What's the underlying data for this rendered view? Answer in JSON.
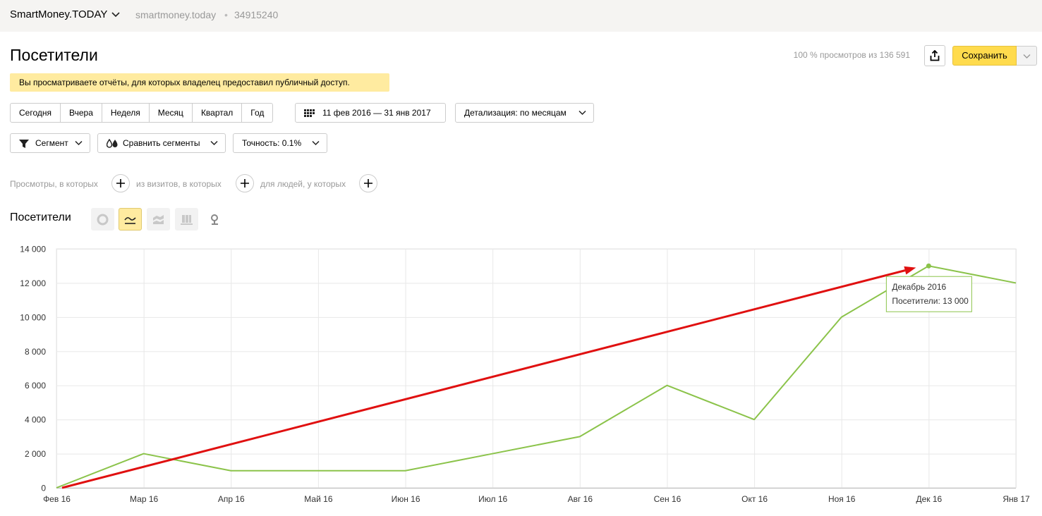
{
  "header": {
    "site_name": "SmartMoney.TODAY",
    "domain": "smartmoney.today",
    "separator": "•",
    "counter_id": "34915240"
  },
  "page": {
    "title": "Посетители",
    "sample_info": "100 % просмотров из 136 591",
    "save_label": "Сохранить",
    "notice": "Вы просматриваете отчёты, для которых владелец предоставил публичный доступ."
  },
  "periods": [
    "Сегодня",
    "Вчера",
    "Неделя",
    "Месяц",
    "Квартал",
    "Год"
  ],
  "date_range": "11 фев 2016 — 31 янв 2017",
  "detail_label": "Детализация: по месяцам",
  "segment_label": "Сегмент",
  "compare_label": "Сравнить сегменты",
  "accuracy_label": "Точность: 0.1%",
  "filters": {
    "views": "Просмотры, в которых",
    "visits": "из визитов, в которых",
    "people": "для людей, у которых"
  },
  "chart_header": {
    "title": "Посетители"
  },
  "tooltip": {
    "title": "Декабрь 2016",
    "value": "Посетители: 13 000"
  },
  "colors": {
    "series": "#8bc34a",
    "annotation_arrow": "#e01010",
    "save_button": "#ffdb4d",
    "notice_bg": "#ffeba0"
  },
  "chart_data": {
    "type": "line",
    "categories": [
      "Фев 16",
      "Мар 16",
      "Апр 16",
      "Май 16",
      "Июн 16",
      "Июл 16",
      "Авг 16",
      "Сен 16",
      "Окт 16",
      "Ноя 16",
      "Дек 16",
      "Янв 17"
    ],
    "series": [
      {
        "values": [
          0,
          2000,
          1000,
          1000,
          1000,
          2000,
          3000,
          6000,
          4000,
          10000,
          13000,
          12000
        ]
      }
    ],
    "y_ticks": [
      "0",
      "2 000",
      "4 000",
      "6 000",
      "8 000",
      "10 000",
      "12 000",
      "14 000"
    ],
    "ylim": [
      0,
      14000
    ],
    "grid": true,
    "highlight_index": 10,
    "annotation": {
      "type": "arrow",
      "from": [
        "Фев 16",
        0
      ],
      "to": [
        "Дек 16",
        12900
      ]
    }
  }
}
